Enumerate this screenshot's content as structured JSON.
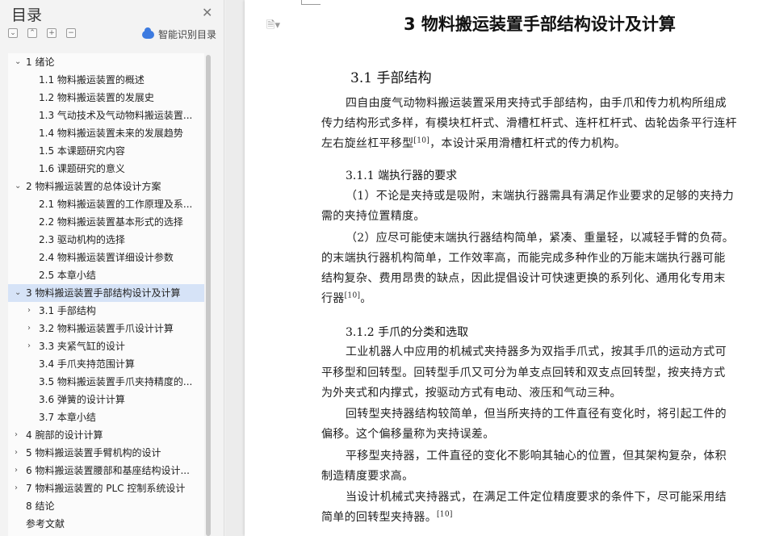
{
  "sidebar": {
    "title": "目录",
    "smart_label": "智能识别目录",
    "toolbar": [
      "⌄",
      "⌃",
      "+",
      "−"
    ],
    "items": [
      {
        "level": 1,
        "caret": "⌄",
        "text": "1  绪论"
      },
      {
        "level": 2,
        "caret": "",
        "text": "1.1  物料搬运装置的概述"
      },
      {
        "level": 2,
        "caret": "",
        "text": "1.2  物料搬运装置的发展史"
      },
      {
        "level": 2,
        "caret": "",
        "text": "1.3  气动技术及气动物料搬运装置..."
      },
      {
        "level": 2,
        "caret": "",
        "text": "1.4  物料搬运装置未来的发展趋势"
      },
      {
        "level": 2,
        "caret": "",
        "text": "1.5  本课题研究内容"
      },
      {
        "level": 2,
        "caret": "",
        "text": "1.6  课题研究的意义"
      },
      {
        "level": 1,
        "caret": "⌄",
        "text": "2  物料搬运装置的总体设计方案"
      },
      {
        "level": 2,
        "caret": "",
        "text": "2.1  物料搬运装置的工作原理及系..."
      },
      {
        "level": 2,
        "caret": "",
        "text": "2.2  物料搬运装置基本形式的选择"
      },
      {
        "level": 2,
        "caret": "",
        "text": "2.3  驱动机构的选择"
      },
      {
        "level": 2,
        "caret": "",
        "text": "2.4  物料搬运装置详细设计参数"
      },
      {
        "level": 2,
        "caret": "",
        "text": "2.5  本章小结"
      },
      {
        "level": 1,
        "caret": "⌄",
        "text": "3  物料搬运装置手部结构设计及计算",
        "active": true
      },
      {
        "level": 2,
        "caret": "›",
        "text": "3.1  手部结构"
      },
      {
        "level": 2,
        "caret": "›",
        "text": "3.2  物料搬运装置手爪设计计算"
      },
      {
        "level": 2,
        "caret": "›",
        "text": "3.3  夹紧气缸的设计"
      },
      {
        "level": 2,
        "caret": "",
        "text": "3.4  手爪夹持范围计算"
      },
      {
        "level": 2,
        "caret": "",
        "text": "3.5  物料搬运装置手爪夹持精度的..."
      },
      {
        "level": 2,
        "caret": "",
        "text": "3.6  弹簧的设计计算"
      },
      {
        "level": 2,
        "caret": "",
        "text": "3.7  本章小结"
      },
      {
        "level": 1,
        "caret": "›",
        "text": "4  腕部的设计计算"
      },
      {
        "level": 1,
        "caret": "›",
        "text": "5  物料搬运装置手臂机构的设计"
      },
      {
        "level": 1,
        "caret": "›",
        "text": "6  物料搬运装置腰部和基座结构设计..."
      },
      {
        "level": 1,
        "caret": "›",
        "text": "7  物料搬运装置的 PLC 控制系统设计"
      },
      {
        "level": 1,
        "caret": "",
        "text": "8  结论"
      },
      {
        "level": 1,
        "caret": "",
        "text": "参考文献"
      }
    ]
  },
  "document": {
    "chapter_title": "3  物料搬运装置手部结构设计及计算",
    "section_title": "3.1  手部结构",
    "sub1_title": "3.1.1  端执行器的要求",
    "sub2_title": "3.1.2  手爪的分类和选取",
    "cite": "[10]",
    "p1": [
      "四自由度气动物料搬运装置采用夹持式手部结构，由手爪和传力机构所组成",
      "传力结构形式多样，有模块杠杆式、滑槽杠杆式、连杆杠杆式、齿轮齿条平行连杆",
      "左右旋丝杠平移型",
      "，本设计采用滑槽杠杆式的传力机构。"
    ],
    "p2": [
      "（1）不论是夹持或是吸附，末端执行器需具有满足作业要求的足够的夹持力",
      "需的夹持位置精度。",
      "（2）应尽可能使末端执行器结构简单，紧凑、重量轻，以减轻手臂的负荷。",
      "的末端执行器机构简单，工作效率高，而能完成多种作业的万能末端执行器可能",
      "结构复杂、费用昂贵的缺点，因此提倡设计可快速更换的系列化、通用化专用末",
      "行器",
      "。"
    ],
    "p3": [
      "工业机器人中应用的机械式夹持器多为双指手爪式，按其手爪的运动方式可",
      "平移型和回转型。回转型手爪又可分为单支点回转和双支点回转型，按夹持方式",
      "为外夹式和内撑式，按驱动方式有电动、液压和气动三种。",
      "回转型夹持器结构较简单，但当所夹持的工件直径有变化时，将引起工件的",
      "偏移。这个偏移量称为夹持误差。",
      "平移型夹持器，工件直径的变化不影响其轴心的位置，但其架构复杂，体积",
      "制造精度要求高。",
      "当设计机械式夹持器式，在满足工件定位精度要求的条件下，尽可能采用结",
      "简单的回转型夹持器。"
    ]
  }
}
